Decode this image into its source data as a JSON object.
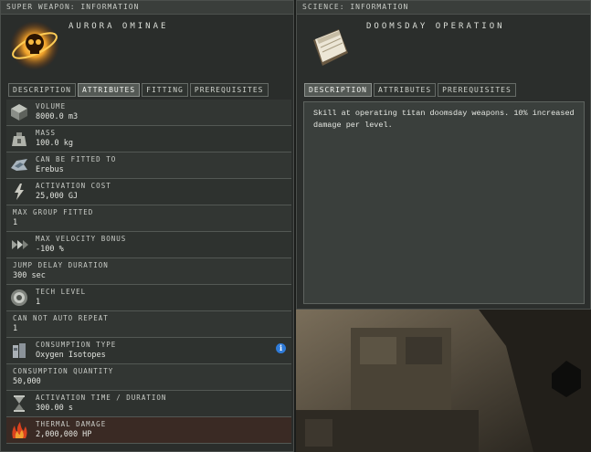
{
  "left_window": {
    "title": "Super Weapon: Information",
    "item_name": "AURORA OMINAE",
    "tabs": [
      {
        "label": "DESCRIPTION",
        "active": false
      },
      {
        "label": "ATTRIBUTES",
        "active": true
      },
      {
        "label": "FITTING",
        "active": false
      },
      {
        "label": "PREREQUISITES",
        "active": false
      }
    ],
    "attributes": [
      {
        "label": "Volume",
        "value": "8000.0 m3",
        "icon": "cube-icon"
      },
      {
        "label": "Mass",
        "value": "100.0 kg",
        "icon": "weight-icon"
      },
      {
        "label": "Can be fitted to",
        "value": "Erebus",
        "icon": "ship-icon"
      },
      {
        "label": "Activation Cost",
        "value": "25,000 GJ",
        "icon": "capacitor-icon"
      },
      {
        "label": "Max Group Fitted",
        "value": "1",
        "icon": ""
      },
      {
        "label": "Max Velocity Bonus",
        "value": "-100 %",
        "icon": "velocity-arrows-icon"
      },
      {
        "label": "Jump Delay Duration",
        "value": "300 sec",
        "icon": ""
      },
      {
        "label": "Tech Level",
        "value": "1",
        "icon": "tech-level-icon"
      },
      {
        "label": "Can not auto repeat",
        "value": "1",
        "icon": ""
      },
      {
        "label": "Consumption Type",
        "value": "Oxygen Isotopes",
        "icon": "isotope-canister-icon",
        "info": "i"
      },
      {
        "label": "Consumption Quantity",
        "value": "50,000",
        "icon": ""
      },
      {
        "label": "Activation time / duration",
        "value": "300.00 s",
        "icon": "hourglass-icon"
      },
      {
        "label": "Thermal Damage",
        "value": "2,000,000 HP",
        "icon": "thermal-flame-icon"
      }
    ]
  },
  "right_window": {
    "title": "Science: Information",
    "item_name": "DOOMSDAY OPERATION",
    "tabs": [
      {
        "label": "DESCRIPTION",
        "active": true
      },
      {
        "label": "ATTRIBUTES",
        "active": false
      },
      {
        "label": "PREREQUISITES",
        "active": false
      }
    ],
    "description": "Skill at operating titan doomsday weapons. 10% increased damage per level."
  },
  "colors": {
    "accent_orange": "#e08a1c",
    "info_blue": "#2f7bd8",
    "panel_bg": "#2a2d2b"
  }
}
